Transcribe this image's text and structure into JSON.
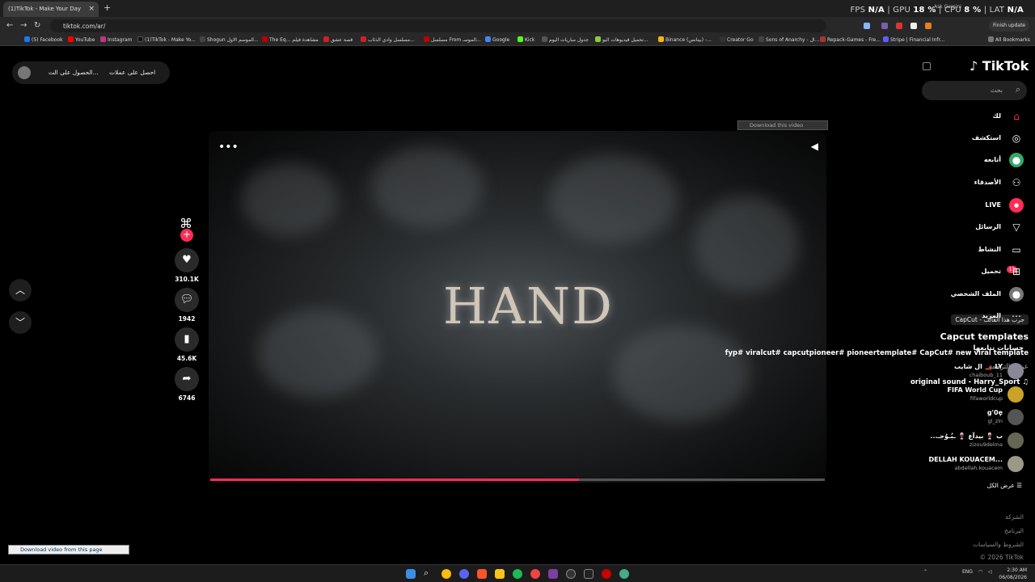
{
  "browser": {
    "tab_title": "(1)TikTok - Make Your Day",
    "tab_close": "×",
    "new_tab": "+",
    "url": "tiktok.com/ar/",
    "finish_update": "Finish update",
    "ask_gemini": "Ask Gemini",
    "hud": {
      "fps_label": "FPS",
      "fps": "N/A",
      "gpu_label": "GPU",
      "gpu": "18 %",
      "cpu_label": "CPU",
      "cpu": "8 %",
      "lat_label": "LAT",
      "lat": "N/A"
    },
    "bookmarks": [
      "(5) Facebook",
      "YouTube",
      "Instagram",
      "(1)TikTok - Make Yo...",
      "Shogun الموسم الاول...",
      "The Eq... مشاهدة فيلم",
      "قصة عشق",
      "مسلسل وادي الذئاب...",
      "مسلسل From الموسـ...",
      "Google",
      "Kick",
      "جدول مباريات اليوم",
      "تحميل فيديوهات اليو...",
      "Binance (بينانس) -...",
      "Creator Go",
      "Sons of Anarchy - ال...",
      "Repack-Games - Fre...",
      "Stripe | Financial Infr..."
    ],
    "all_bookmarks": "All Bookmarks"
  },
  "topbar": {
    "get_coins": "احصل على عملات",
    "get_app": "الحصول على الت..."
  },
  "video": {
    "overlay_text": "HAND",
    "download_overlay": "Download this video",
    "capcut_badge": "CapCut - جرب هذا القالب",
    "title": "Capcut templates",
    "hashtags": "fyp# viralcut# capcutpioneer# pioneertemplate# CapCut# new viral template",
    "translate": "عرض الترجمة",
    "sound": "original sound - Harry_Sport",
    "progress": 0.6
  },
  "actions": {
    "likes": "310.1K",
    "comments": "1942",
    "saves": "45.6K",
    "shares": "6746"
  },
  "sidebar": {
    "logo": "TikTok",
    "search_placeholder": "بحث",
    "menu": [
      {
        "label": "لك",
        "icon": "home-icon"
      },
      {
        "label": "استكشف",
        "icon": "compass-icon"
      },
      {
        "label": "أتابعه",
        "icon": "following-icon"
      },
      {
        "label": "الأصدقاء",
        "icon": "friends-icon"
      },
      {
        "label": "LIVE",
        "icon": "live-icon"
      },
      {
        "label": "الرسائل",
        "icon": "messages-icon"
      },
      {
        "label": "النشاط",
        "icon": "activity-icon"
      },
      {
        "label": "تحميل",
        "icon": "upload-icon"
      },
      {
        "label": "الملف الشخصي",
        "icon": "profile-icon"
      },
      {
        "label": "المزيد",
        "icon": "more-icon"
      }
    ],
    "messages_badge": "11",
    "following_heading": "حسابات تتابعها",
    "accounts": [
      {
        "name": "ال شايب 🏎️ LY",
        "handle": "chaiboub_11"
      },
      {
        "name": "FIFA World Cup",
        "handle": "fifaworldcup"
      },
      {
        "name": "g'0ȩ",
        "handle": "gl_zln"
      },
      {
        "name": "...ب 🍷 بيدآع 🍷 ـبُـوُجـ",
        "handle": "zizou9delma"
      },
      {
        "name": "DELLAH KOUACEM...",
        "handle": "abdellah.kouacem"
      }
    ],
    "see_all": "عرض الكل",
    "footer": [
      "الشركة",
      "البرنامج",
      "الشروط والسياسات",
      "© 2026 TikTok"
    ]
  },
  "download_page": "Download video from this page",
  "taskbar": {
    "lang": "ENG",
    "time": "2:30 AM",
    "date": "06/08/2026"
  }
}
